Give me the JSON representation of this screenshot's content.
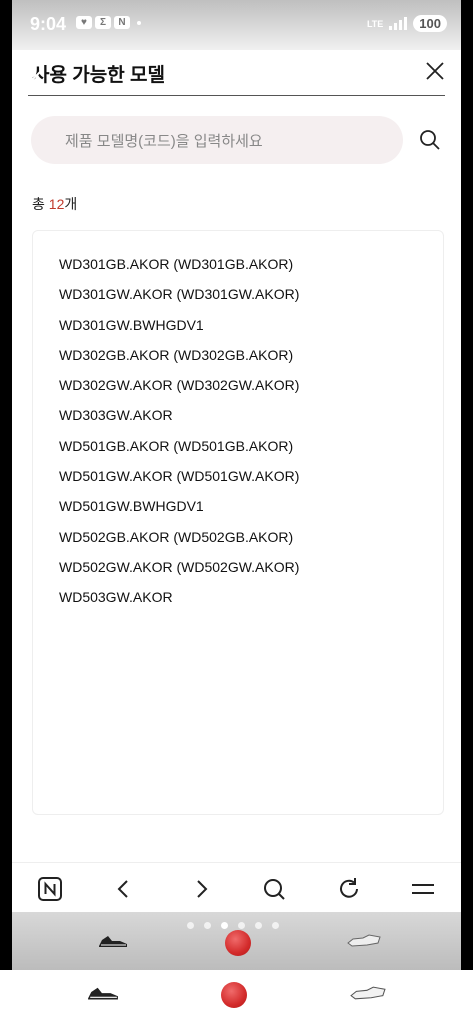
{
  "status_bar": {
    "time": "9:04",
    "indicators": [
      "heart-icon",
      "sigma-icon",
      "n-icon"
    ],
    "network": "LTE",
    "battery": "100"
  },
  "header": {
    "title": "사용 가능한 모델"
  },
  "search": {
    "placeholder": "제품 모델명(코드)을 입력하세요",
    "value": ""
  },
  "result": {
    "prefix": "총 ",
    "count": "12",
    "suffix": "개"
  },
  "models": [
    "WD301GB.AKOR (WD301GB.AKOR)",
    "WD301GW.AKOR (WD301GW.AKOR)",
    "WD301GW.BWHGDV1",
    "WD302GB.AKOR (WD302GB.AKOR)",
    "WD302GW.AKOR (WD302GW.AKOR)",
    "WD303GW.AKOR",
    "WD501GB.AKOR (WD501GB.AKOR)",
    "WD501GW.AKOR (WD501GW.AKOR)",
    "WD501GW.BWHGDV1",
    "WD502GB.AKOR (WD502GB.AKOR)",
    "WD502GW.AKOR (WD502GW.AKOR)",
    "WD503GW.AKOR"
  ],
  "browser_bar": {
    "buttons": [
      "naver-home-icon",
      "back-icon",
      "forward-icon",
      "search-icon",
      "refresh-icon",
      "menu-icon"
    ]
  },
  "dock": {
    "page_count": 6,
    "active_page": 3,
    "apps": [
      "sneaker-black-icon",
      "red-ball-icon",
      "sneaker-white-icon"
    ]
  },
  "colors": {
    "accent_count": "#c0392b",
    "search_bg": "#f5eff0"
  }
}
